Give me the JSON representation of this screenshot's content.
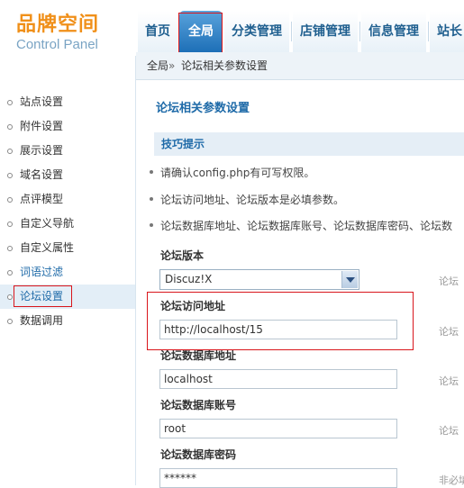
{
  "logo": {
    "title": "品牌空间",
    "subtitle": "Control Panel"
  },
  "nav": {
    "items": [
      {
        "label": "首页"
      },
      {
        "label": "全局"
      },
      {
        "label": "分类管理"
      },
      {
        "label": "店铺管理"
      },
      {
        "label": "信息管理"
      },
      {
        "label": "站长"
      }
    ],
    "active_index": 1
  },
  "breadcrumb": {
    "root": "全局",
    "sep": "»",
    "current": "论坛相关参数设置"
  },
  "sidebar": {
    "items": [
      {
        "label": "站点设置"
      },
      {
        "label": "附件设置"
      },
      {
        "label": "展示设置"
      },
      {
        "label": "域名设置"
      },
      {
        "label": "点评模型"
      },
      {
        "label": "自定义导航"
      },
      {
        "label": "自定义属性"
      },
      {
        "label": "词语过滤"
      },
      {
        "label": "论坛设置"
      },
      {
        "label": "数据调用"
      }
    ],
    "active_index": 8
  },
  "main": {
    "title": "论坛相关参数设置",
    "tips_title": "技巧提示",
    "tips": [
      "请确认config.php有可写权限。",
      "论坛访问地址、论坛版本是必填参数。",
      "论坛数据库地址、论坛数据库账号、论坛数据库密码、论坛数"
    ],
    "fields": {
      "version": {
        "label": "论坛版本",
        "value": "Discuz!X",
        "hint": "论坛"
      },
      "url": {
        "label": "论坛访问地址",
        "value": "http://localhost/15",
        "hint": "论坛"
      },
      "db_host": {
        "label": "论坛数据库地址",
        "value": "localhost",
        "hint": "论坛"
      },
      "db_user": {
        "label": "论坛数据库账号",
        "value": "root",
        "hint": "论坛"
      },
      "db_pass": {
        "label": "论坛数据库密码",
        "value": "******",
        "hint": "非必填"
      }
    }
  },
  "colors": {
    "accent": "#1e6aa8",
    "logo": "#f0901a",
    "highlight": "#d9151b"
  }
}
